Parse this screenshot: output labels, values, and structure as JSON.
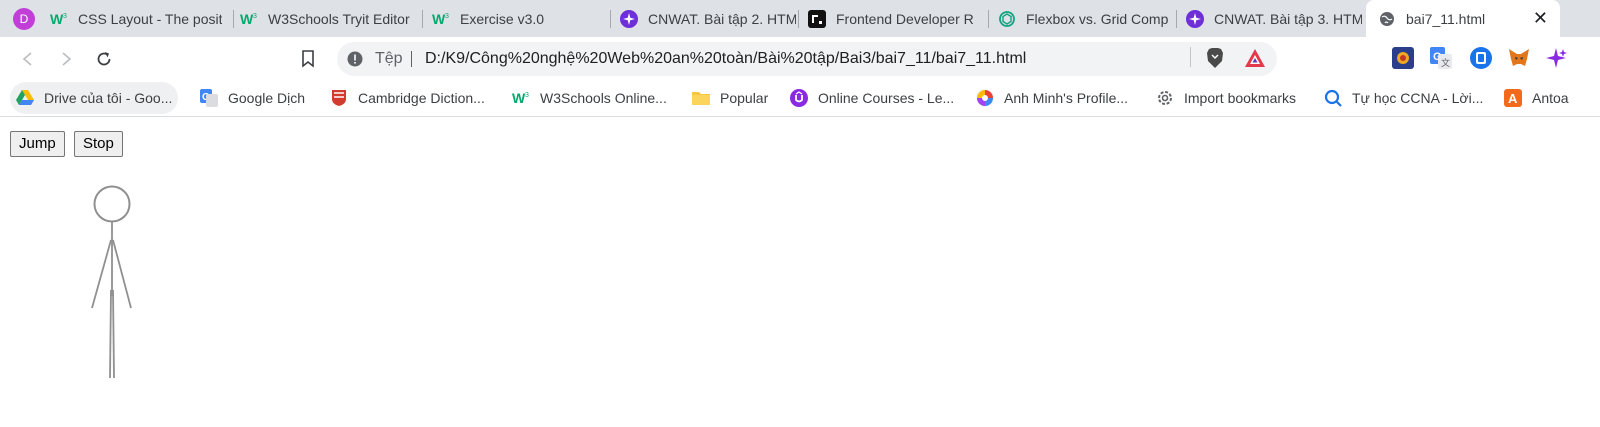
{
  "browser": {
    "profile_initial": "D",
    "tabs": [
      {
        "title": "CSS Layout - The posit",
        "icon": "w3schools-icon"
      },
      {
        "title": "W3Schools Tryit Editor",
        "icon": "w3schools-icon"
      },
      {
        "title": "Exercise v3.0",
        "icon": "w3schools-icon"
      },
      {
        "title": "CNWAT. Bài tập 2. HTM",
        "icon": "sparkle-icon"
      },
      {
        "title": "Frontend Developer R",
        "icon": "roadmap-icon"
      },
      {
        "title": "Flexbox vs. Grid Comp",
        "icon": "openai-icon"
      },
      {
        "title": "CNWAT. Bài tập 3. HTM",
        "icon": "sparkle-icon"
      },
      {
        "title": "bai7_11.html",
        "icon": "globe-icon",
        "active": true
      }
    ],
    "close_glyph": "✕"
  },
  "toolbar": {
    "back": "back-arrow-icon",
    "forward": "forward-arrow-icon",
    "reload": "reload-icon",
    "bookmark": "bookmark-icon",
    "omnibox": {
      "info_icon": "info-icon",
      "label": "Tệp",
      "url": "D:/K9/Công%20nghệ%20Web%20an%20toàn/Bài%20tập/Bai3/bai7_11/bai7_11.html"
    },
    "extensions": [
      "brave-icon",
      "triangle-icon",
      "extension-puzzle-icon",
      "google-translate-icon",
      "bitwarden-icon",
      "metamask-icon",
      "sparkle-icon"
    ]
  },
  "bookmarks": [
    {
      "label": "Drive của tôi - Goo...",
      "icon": "google-drive-icon"
    },
    {
      "label": "Google Dịch",
      "icon": "google-translate-icon"
    },
    {
      "label": "Cambridge Diction...",
      "icon": "cambridge-icon"
    },
    {
      "label": "W3Schools Online...",
      "icon": "w3schools-icon"
    },
    {
      "label": "Popular",
      "icon": "folder-icon"
    },
    {
      "label": "Online Courses - Le...",
      "icon": "udemy-icon"
    },
    {
      "label": "Anh Minh's Profile...",
      "icon": "swirl-icon"
    },
    {
      "label": "Import bookmarks",
      "icon": "gear-icon"
    },
    {
      "label": "Tự học CCNA - Lời...",
      "icon": "search-icon"
    },
    {
      "label": "Antoa",
      "icon": "a-letter-icon"
    }
  ],
  "page": {
    "jump_label": "Jump",
    "stop_label": "Stop"
  },
  "colors": {
    "tabstrip": "#dee1e6",
    "w3schools": "#04aa6d",
    "sparkle": "#8a2be2"
  }
}
